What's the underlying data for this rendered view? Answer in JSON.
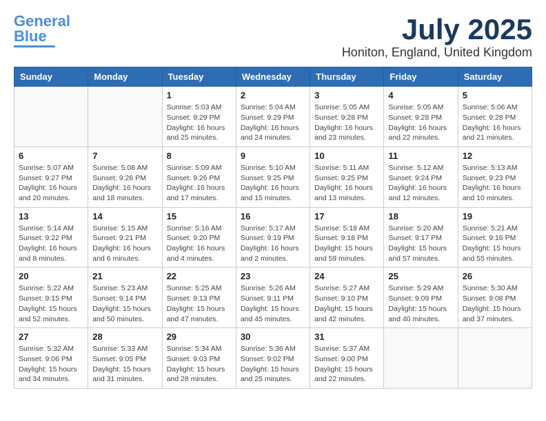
{
  "header": {
    "logo_line1": "General",
    "logo_line2": "Blue",
    "month_year": "July 2025",
    "location": "Honiton, England, United Kingdom"
  },
  "weekdays": [
    "Sunday",
    "Monday",
    "Tuesday",
    "Wednesday",
    "Thursday",
    "Friday",
    "Saturday"
  ],
  "weeks": [
    [
      {
        "day": "",
        "info": ""
      },
      {
        "day": "",
        "info": ""
      },
      {
        "day": "1",
        "info": "Sunrise: 5:03 AM\nSunset: 9:29 PM\nDaylight: 16 hours\nand 25 minutes."
      },
      {
        "day": "2",
        "info": "Sunrise: 5:04 AM\nSunset: 9:29 PM\nDaylight: 16 hours\nand 24 minutes."
      },
      {
        "day": "3",
        "info": "Sunrise: 5:05 AM\nSunset: 9:28 PM\nDaylight: 16 hours\nand 23 minutes."
      },
      {
        "day": "4",
        "info": "Sunrise: 5:05 AM\nSunset: 9:28 PM\nDaylight: 16 hours\nand 22 minutes."
      },
      {
        "day": "5",
        "info": "Sunrise: 5:06 AM\nSunset: 9:28 PM\nDaylight: 16 hours\nand 21 minutes."
      }
    ],
    [
      {
        "day": "6",
        "info": "Sunrise: 5:07 AM\nSunset: 9:27 PM\nDaylight: 16 hours\nand 20 minutes."
      },
      {
        "day": "7",
        "info": "Sunrise: 5:08 AM\nSunset: 9:26 PM\nDaylight: 16 hours\nand 18 minutes."
      },
      {
        "day": "8",
        "info": "Sunrise: 5:09 AM\nSunset: 9:26 PM\nDaylight: 16 hours\nand 17 minutes."
      },
      {
        "day": "9",
        "info": "Sunrise: 5:10 AM\nSunset: 9:25 PM\nDaylight: 16 hours\nand 15 minutes."
      },
      {
        "day": "10",
        "info": "Sunrise: 5:11 AM\nSunset: 9:25 PM\nDaylight: 16 hours\nand 13 minutes."
      },
      {
        "day": "11",
        "info": "Sunrise: 5:12 AM\nSunset: 9:24 PM\nDaylight: 16 hours\nand 12 minutes."
      },
      {
        "day": "12",
        "info": "Sunrise: 5:13 AM\nSunset: 9:23 PM\nDaylight: 16 hours\nand 10 minutes."
      }
    ],
    [
      {
        "day": "13",
        "info": "Sunrise: 5:14 AM\nSunset: 9:22 PM\nDaylight: 16 hours\nand 8 minutes."
      },
      {
        "day": "14",
        "info": "Sunrise: 5:15 AM\nSunset: 9:21 PM\nDaylight: 16 hours\nand 6 minutes."
      },
      {
        "day": "15",
        "info": "Sunrise: 5:16 AM\nSunset: 9:20 PM\nDaylight: 16 hours\nand 4 minutes."
      },
      {
        "day": "16",
        "info": "Sunrise: 5:17 AM\nSunset: 9:19 PM\nDaylight: 16 hours\nand 2 minutes."
      },
      {
        "day": "17",
        "info": "Sunrise: 5:18 AM\nSunset: 9:18 PM\nDaylight: 15 hours\nand 59 minutes."
      },
      {
        "day": "18",
        "info": "Sunrise: 5:20 AM\nSunset: 9:17 PM\nDaylight: 15 hours\nand 57 minutes."
      },
      {
        "day": "19",
        "info": "Sunrise: 5:21 AM\nSunset: 9:16 PM\nDaylight: 15 hours\nand 55 minutes."
      }
    ],
    [
      {
        "day": "20",
        "info": "Sunrise: 5:22 AM\nSunset: 9:15 PM\nDaylight: 15 hours\nand 52 minutes."
      },
      {
        "day": "21",
        "info": "Sunrise: 5:23 AM\nSunset: 9:14 PM\nDaylight: 15 hours\nand 50 minutes."
      },
      {
        "day": "22",
        "info": "Sunrise: 5:25 AM\nSunset: 9:13 PM\nDaylight: 15 hours\nand 47 minutes."
      },
      {
        "day": "23",
        "info": "Sunrise: 5:26 AM\nSunset: 9:11 PM\nDaylight: 15 hours\nand 45 minutes."
      },
      {
        "day": "24",
        "info": "Sunrise: 5:27 AM\nSunset: 9:10 PM\nDaylight: 15 hours\nand 42 minutes."
      },
      {
        "day": "25",
        "info": "Sunrise: 5:29 AM\nSunset: 9:09 PM\nDaylight: 15 hours\nand 40 minutes."
      },
      {
        "day": "26",
        "info": "Sunrise: 5:30 AM\nSunset: 9:08 PM\nDaylight: 15 hours\nand 37 minutes."
      }
    ],
    [
      {
        "day": "27",
        "info": "Sunrise: 5:32 AM\nSunset: 9:06 PM\nDaylight: 15 hours\nand 34 minutes."
      },
      {
        "day": "28",
        "info": "Sunrise: 5:33 AM\nSunset: 9:05 PM\nDaylight: 15 hours\nand 31 minutes."
      },
      {
        "day": "29",
        "info": "Sunrise: 5:34 AM\nSunset: 9:03 PM\nDaylight: 15 hours\nand 28 minutes."
      },
      {
        "day": "30",
        "info": "Sunrise: 5:36 AM\nSunset: 9:02 PM\nDaylight: 15 hours\nand 25 minutes."
      },
      {
        "day": "31",
        "info": "Sunrise: 5:37 AM\nSunset: 9:00 PM\nDaylight: 15 hours\nand 22 minutes."
      },
      {
        "day": "",
        "info": ""
      },
      {
        "day": "",
        "info": ""
      }
    ]
  ]
}
